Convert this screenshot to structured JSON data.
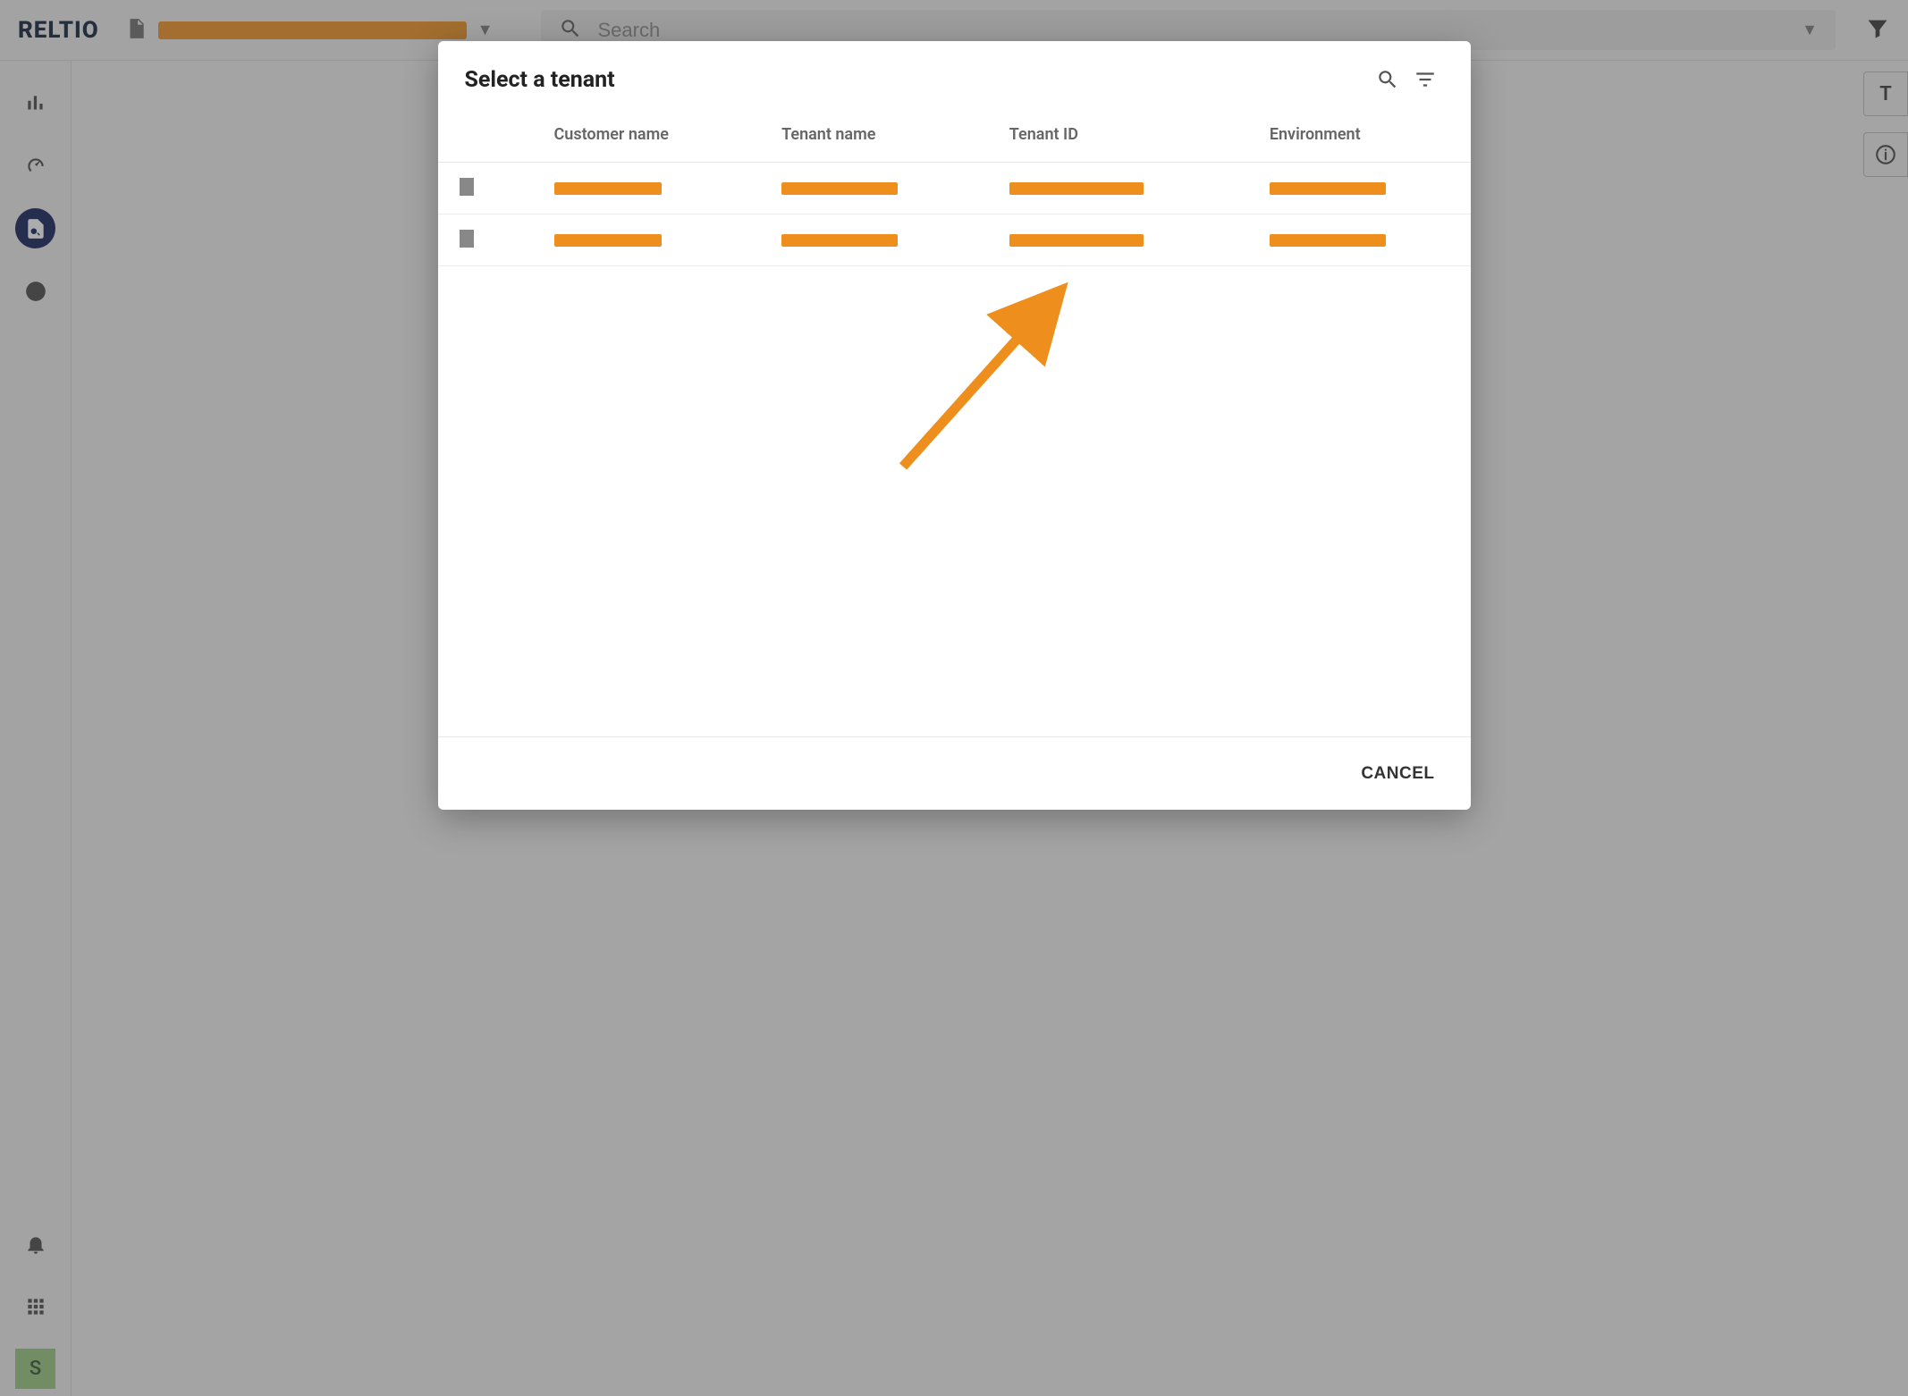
{
  "app": {
    "logo": "RELTIO"
  },
  "header": {
    "tenant_display": "[redacted]",
    "search_placeholder": "Search"
  },
  "right_fragment_text": "T",
  "sidebar": {
    "avatar_initial": "S"
  },
  "dialog": {
    "title": "Select a tenant",
    "columns": {
      "customer": "Customer name",
      "tenant_name": "Tenant name",
      "tenant_id": "Tenant ID",
      "environment": "Environment"
    },
    "rows": [
      {
        "customer": "[redacted]",
        "tenant_name": "[redacted]",
        "tenant_id": "[redacted]",
        "environment": "[redacted]"
      },
      {
        "customer": "[redacted]",
        "tenant_name": "[redacted]",
        "tenant_id": "[redacted]",
        "environment": "[redacted]"
      }
    ],
    "cancel_label": "CANCEL"
  }
}
